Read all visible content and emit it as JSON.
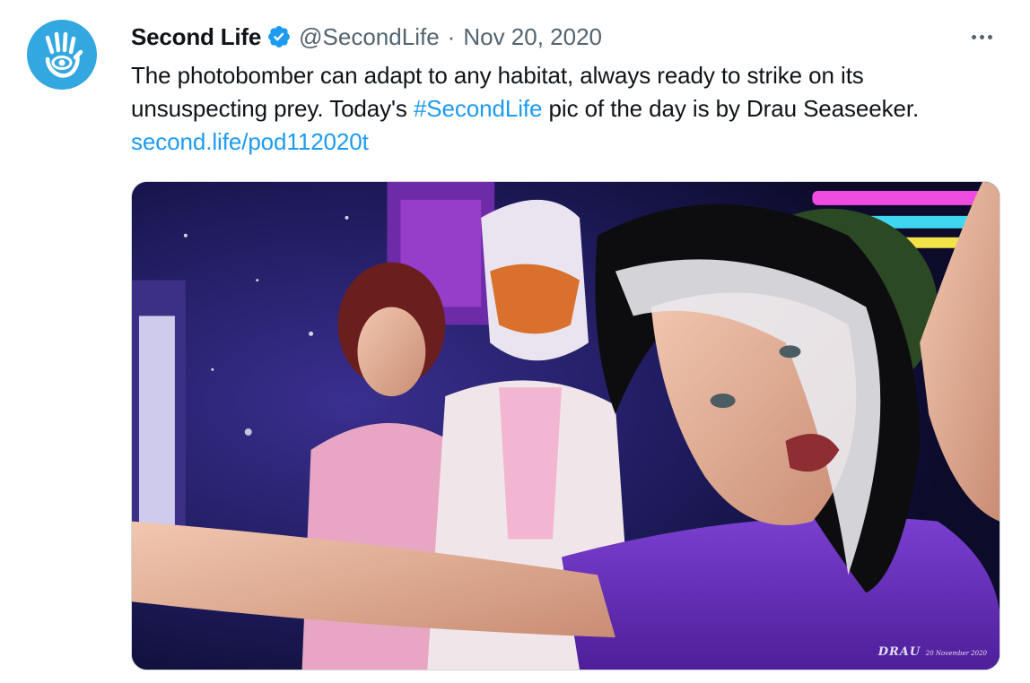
{
  "tweet": {
    "author": {
      "display_name": "Second Life",
      "handle": "@SecondLife",
      "verified": true,
      "avatar_icon": "hand-eye-logo-icon",
      "avatar_color": "#33a7e0"
    },
    "separator": "·",
    "date": "Nov 20, 2020",
    "more_icon": "more-options-icon",
    "text": {
      "part1": "The photobomber can adapt to any habitat, always ready to strike on its unsuspecting prey. Today's ",
      "hashtag": "#SecondLife",
      "part2": " pic of the day is by Drau Seaseeker. ",
      "url": "second.life/pod112020t"
    },
    "media": {
      "description_icon": "photo-image",
      "watermark": "DRAU",
      "watermark_sub": "20 November 2020"
    },
    "colors": {
      "link": "#1d9bf0",
      "text": "#0f1419",
      "muted": "#536471",
      "verified_badge": "#1d9bf0"
    }
  }
}
